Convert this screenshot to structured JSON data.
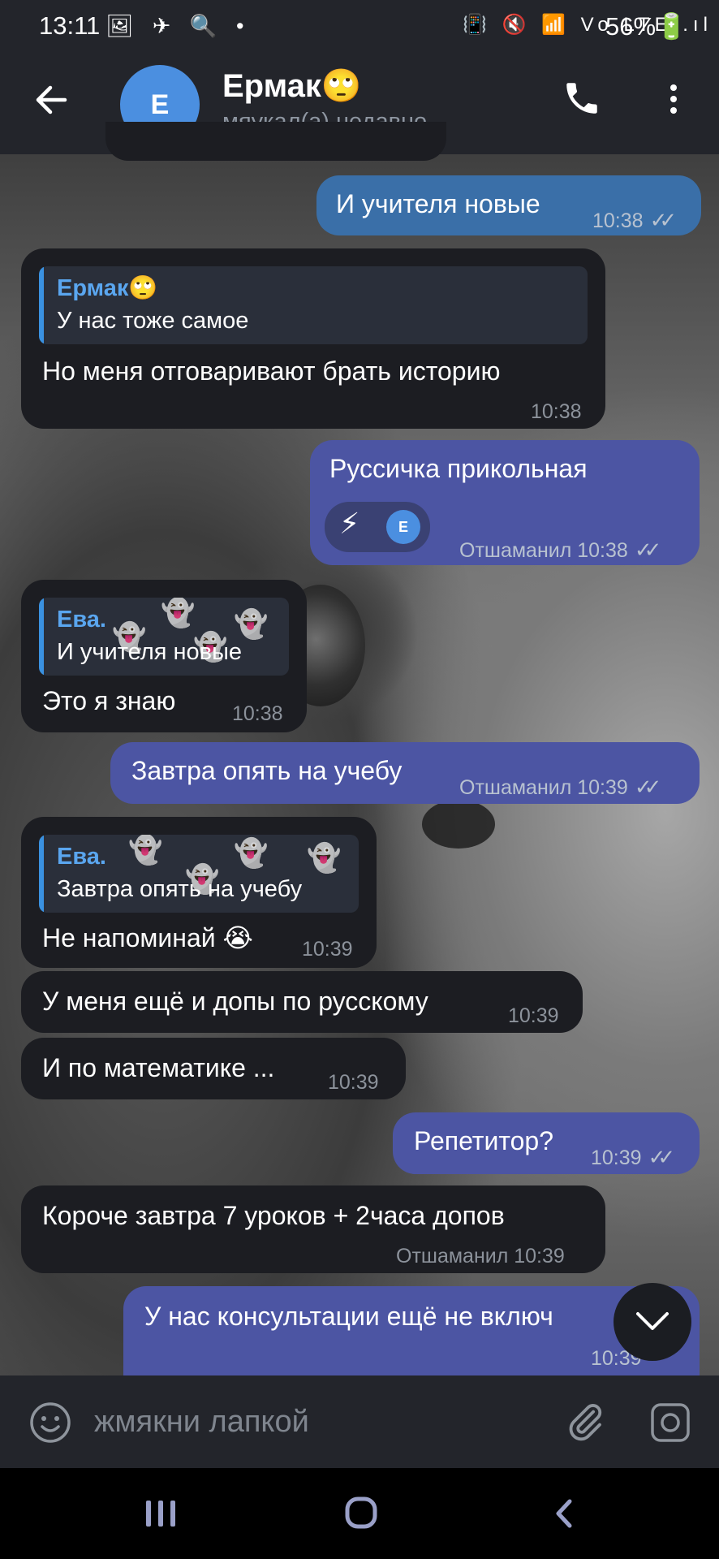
{
  "status_bar": {
    "time": "13:11",
    "left_icons": "🖼 ✈ 🔍 •",
    "right_icons": "📳 🔇 📶 Vo LTE .ıl",
    "battery": "56%🔋"
  },
  "header": {
    "back_icon": "arrow-left",
    "avatar_letter": "E",
    "title": "Ермак🙄",
    "subtitle": "мяукал(а) недавно"
  },
  "messages": [
    {
      "text": "И учителя новые",
      "time": "10:38",
      "ticks": "✓✓"
    },
    {
      "reply_name": "Ермак🙄",
      "reply_text": "У нас тоже самое",
      "text": "Но меня отговаривают брать историю",
      "time": "10:38"
    },
    {
      "text": "Руссичка прикольная",
      "reaction": "⚡",
      "reaction_avatar": "E",
      "time": "Отшаманил 10:38",
      "ticks": "✓✓"
    },
    {
      "reply_name": "Ева.",
      "reply_text": "И учителя новые",
      "text": "Это я знаю",
      "time": "10:38"
    },
    {
      "text": "Завтра опять на учебу",
      "time": "Отшаманил 10:39",
      "ticks": "✓✓"
    },
    {
      "reply_name": "Ева.",
      "reply_text": "Завтра опять на учебу",
      "text": "Не напоминай 😭",
      "time": "10:39"
    },
    {
      "text": "У меня ещё и допы по русскому",
      "time": "10:39"
    },
    {
      "text": "И по математике ...",
      "time": "10:39"
    },
    {
      "text": "Репетитор?",
      "time": "10:39",
      "ticks": "✓✓"
    },
    {
      "text": "Короче завтра 7 уроков + 2часа допов",
      "time": "Отшаманил 10:39"
    },
    {
      "text": "У нас консультации ещё не включ",
      "time": "10:39"
    }
  ],
  "input": {
    "placeholder": "жмякни лапкой"
  },
  "icons": {
    "emoji": "smile-icon",
    "attach": "paperclip-icon",
    "camera": "camera-icon",
    "scroll_down": "chevron-down-icon"
  }
}
